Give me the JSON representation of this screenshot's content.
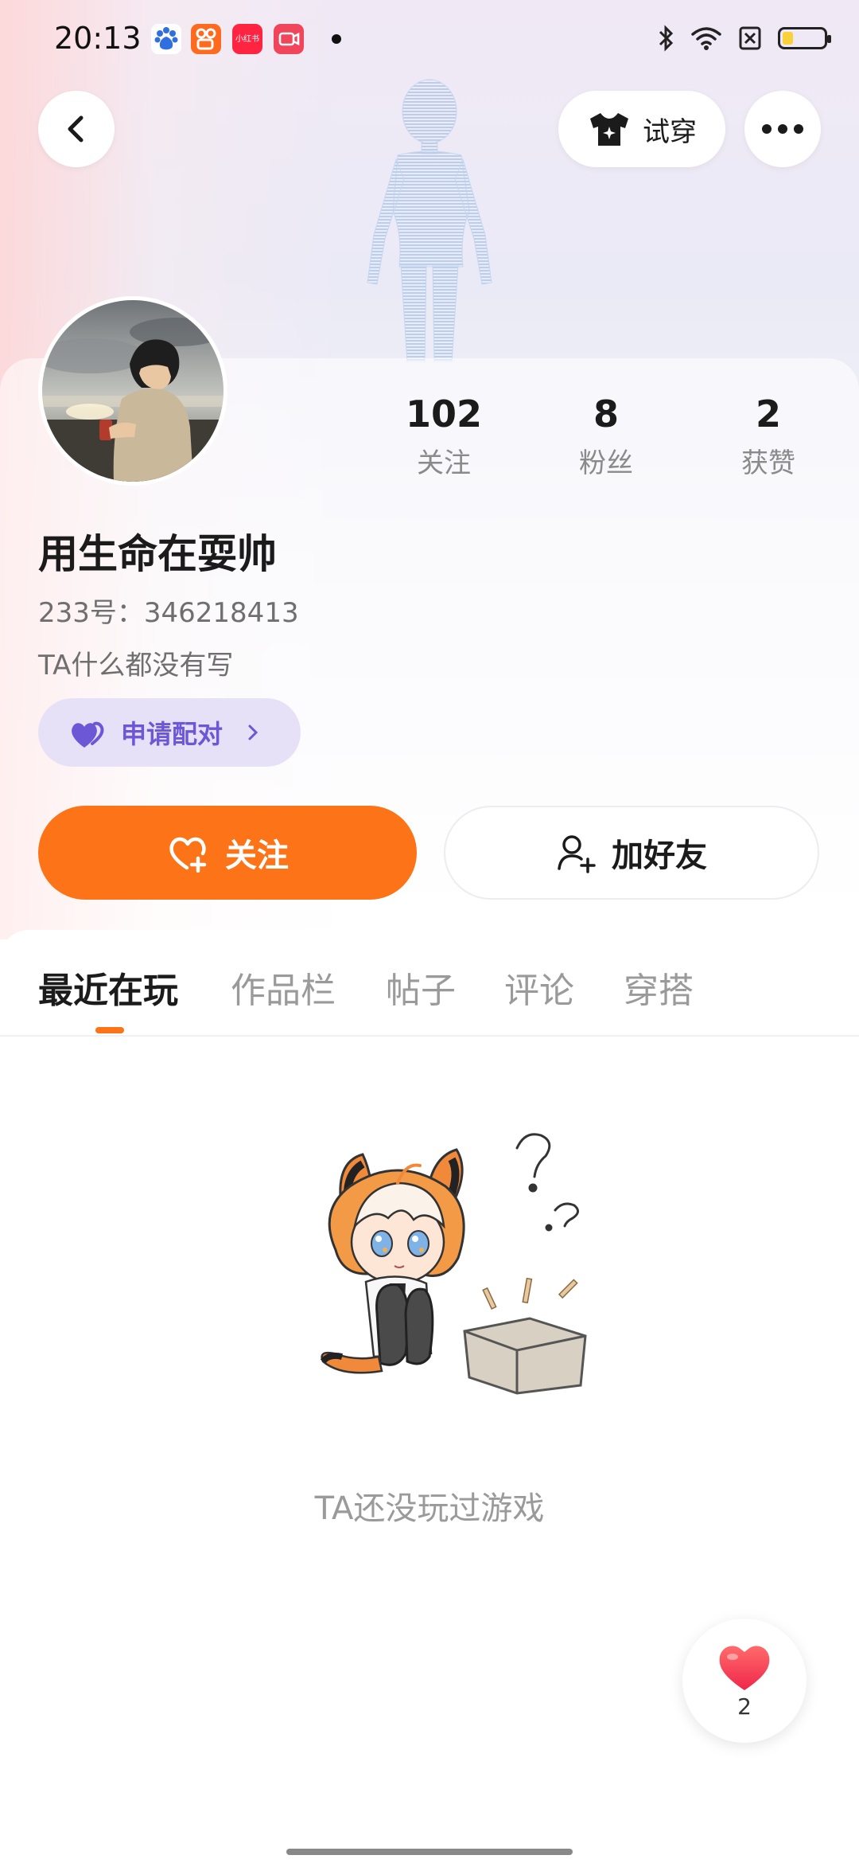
{
  "status_bar": {
    "time": "20:13",
    "notif_icons": [
      "baidu-icon",
      "kuaishou-icon",
      "xiaohongshu-icon",
      "video-app-icon"
    ],
    "xhs_label": "小红书",
    "battery_level": 0.25
  },
  "top_bar": {
    "try_on_label": "试穿"
  },
  "profile": {
    "name": "用生命在耍帅",
    "uid": "233号：346218413",
    "bio": "TA什么都没有写",
    "pair_label": "申请配对",
    "stats": [
      {
        "value": "102",
        "label": "关注"
      },
      {
        "value": "8",
        "label": "粉丝"
      },
      {
        "value": "2",
        "label": "获赞"
      }
    ]
  },
  "actions": {
    "follow_label": "关注",
    "add_friend_label": "加好友"
  },
  "tabs": [
    {
      "label": "最近在玩",
      "active": true
    },
    {
      "label": "作品栏",
      "active": false
    },
    {
      "label": "帖子",
      "active": false
    },
    {
      "label": "评论",
      "active": false
    },
    {
      "label": "穿搭",
      "active": false
    }
  ],
  "empty_state": {
    "text": "TA还没玩过游戏"
  },
  "like_fab": {
    "count": "2"
  },
  "colors": {
    "accent": "#fc7417",
    "pair_purple": "#6c58d6"
  }
}
